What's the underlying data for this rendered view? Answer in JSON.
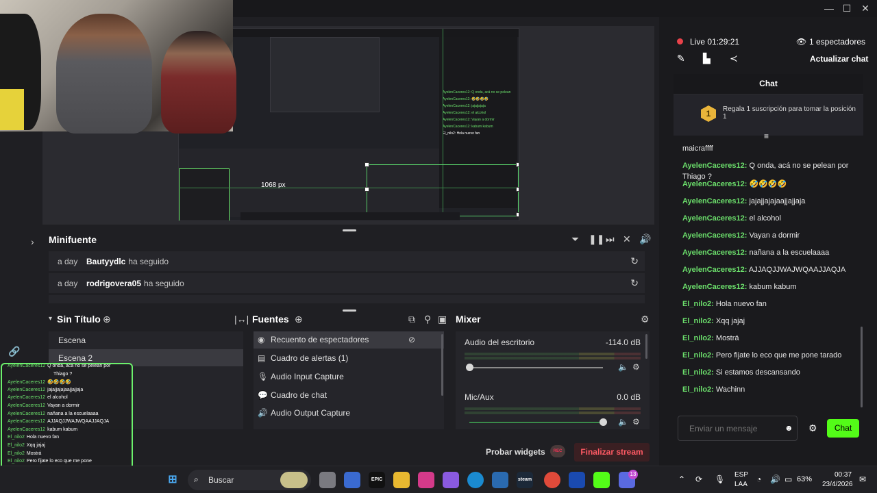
{
  "window": {
    "minimize": "—",
    "maximize": "☐",
    "close": "✕"
  },
  "preview": {
    "canvas_readout": "1068 px"
  },
  "minifuente": {
    "title": "Minifuente",
    "events": [
      {
        "time": "a day",
        "user": "Bautyydlc",
        "action": "ha seguido"
      },
      {
        "time": "a day",
        "user": "rodrigovera05",
        "action": "ha seguido"
      }
    ]
  },
  "scenes": {
    "title": "Sin Título",
    "items": [
      "Escena",
      "Escena 2"
    ]
  },
  "sources": {
    "title": "Fuentes",
    "items": [
      {
        "label": "Recuento de espectadores",
        "icon": "eye-icon"
      },
      {
        "label": "Cuadro de alertas (1)",
        "icon": "window-icon"
      },
      {
        "label": "Audio Input Capture",
        "icon": "microphone-icon"
      },
      {
        "label": "Cuadro de chat",
        "icon": "chat-icon"
      },
      {
        "label": "Audio Output Capture",
        "icon": "speaker-icon"
      }
    ]
  },
  "mixer": {
    "title": "Mixer",
    "channels": [
      {
        "name": "Audio del escritorio",
        "db": "-114.0 dB",
        "level": 0.0
      },
      {
        "name": "Mic/Aux",
        "db": "0.0 dB",
        "level": 1.0
      }
    ]
  },
  "bottom": {
    "probar": "Probar widgets",
    "rec": "REC",
    "finalizar": "Finalizar stream"
  },
  "overlay_chat": [
    {
      "user": "AyelenCaceres12",
      "text": "Q onda, acá no se pelean por"
    },
    {
      "user": "",
      "text": "Thiago ?"
    },
    {
      "user": "AyelenCaceres12",
      "text": "🤣🤣🤣🤣"
    },
    {
      "user": "AyelenCaceres12",
      "text": "jajajjajajaajjajjaja"
    },
    {
      "user": "AyelenCaceres12",
      "text": "el alcohol"
    },
    {
      "user": "AyelenCaceres12",
      "text": "Vayan a dormir"
    },
    {
      "user": "AyelenCaceres12",
      "text": "nañana a la escuelaaaa"
    },
    {
      "user": "AyelenCaceres12",
      "text": "AJJAQJJWAJWQAAJJAQJA"
    },
    {
      "user": "AyelenCaceres12",
      "text": "kabum kabum"
    },
    {
      "user": "El_nilo2",
      "text": "Hola nuevo fan"
    },
    {
      "user": "El_nilo2",
      "text": "Xqq jajaj"
    },
    {
      "user": "El_nilo2",
      "text": "Mostrá"
    },
    {
      "user": "El_nilo2",
      "text": "Pero fijate lo eco que me pone"
    },
    {
      "user": "",
      "text": "tarado"
    },
    {
      "user": "El_nilo2",
      "text": "Si estamos descansando"
    },
    {
      "user": "El_nilo2",
      "text": "Wachinn"
    }
  ],
  "live": {
    "status": "Live 01:29:21",
    "viewers": "1 espectadores",
    "actualizar": "Actualizar chat",
    "chat_header": "Chat",
    "sub_badge": "1",
    "sub_text": "Regala 1 suscripción para tomar la posición 1",
    "messages": [
      {
        "user": "",
        "text": "maicraffff"
      },
      {
        "user": "AyelenCaceres12:",
        "text": "Q onda, acá no se pelean por Thiago ?"
      },
      {
        "user": "AyelenCaceres12:",
        "text": "🤣🤣🤣🤣"
      },
      {
        "user": "AyelenCaceres12:",
        "text": "jajajjajajaajjajjaja"
      },
      {
        "user": "AyelenCaceres12:",
        "text": "el alcohol"
      },
      {
        "user": "AyelenCaceres12:",
        "text": "Vayan a dormir"
      },
      {
        "user": "AyelenCaceres12:",
        "text": "nañana a la escuelaaaa"
      },
      {
        "user": "AyelenCaceres12:",
        "text": "AJJAQJJWAJWQAAJJAQJA"
      },
      {
        "user": "AyelenCaceres12:",
        "text": "kabum kabum"
      },
      {
        "user": "El_nilo2:",
        "text": "Hola nuevo fan"
      },
      {
        "user": "El_nilo2:",
        "text": "Xqq jajaj"
      },
      {
        "user": "El_nilo2:",
        "text": "Mostrá"
      },
      {
        "user": "El_nilo2:",
        "text": "Pero fijate lo eco que me pone tarado"
      },
      {
        "user": "El_nilo2:",
        "text": "Si estamos descansando"
      },
      {
        "user": "El_nilo2:",
        "text": "Wachinn"
      }
    ],
    "input_placeholder": "Enviar un mensaje",
    "send": "Chat",
    "accent": "#53fc18"
  },
  "taskbar": {
    "search": "Buscar",
    "apps": [
      "EPIC",
      "steam",
      "OBS"
    ],
    "badge_count": "13",
    "lang": "ESP",
    "region": "LAA",
    "battery": "63%",
    "time": "00:37",
    "date": "23/4/2026"
  }
}
